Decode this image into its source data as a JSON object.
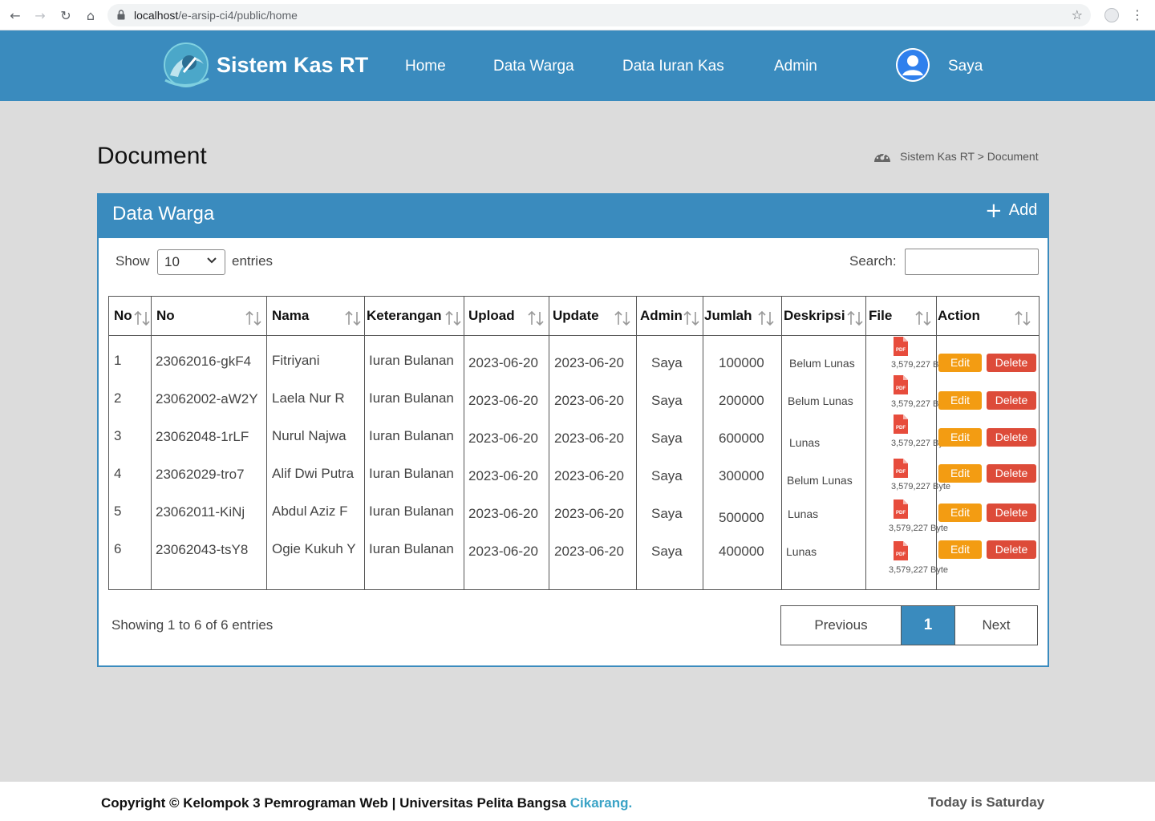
{
  "browser": {
    "url_host": "localhost",
    "url_path": "/e-arsip-ci4/public/home"
  },
  "header": {
    "brand": "Sistem Kas RT",
    "nav": [
      "Home",
      "Data Warga",
      "Data Iuran Kas",
      "Admin"
    ],
    "user": "Saya"
  },
  "page": {
    "title": "Document",
    "breadcrumb": "Sistem Kas RT > Document"
  },
  "card": {
    "title": "Data Warga",
    "add_label": "Add",
    "show_label": "Show",
    "page_length": "10",
    "entries_label": "entries",
    "search_label": "Search:",
    "search_value": ""
  },
  "table": {
    "columns": [
      "No",
      "No",
      "Nama",
      "Keterangan",
      "Upload",
      "Update",
      "Admin",
      "Jumlah",
      "Deskripsi",
      "File",
      "Action"
    ],
    "rows": [
      {
        "no": "1",
        "code": "23062016-gkF4",
        "nama": "Fitriyani",
        "ket": "Iuran Bulanan",
        "upload": "2023-06-20",
        "update": "2023-06-20",
        "admin": "Saya",
        "jumlah": "100000",
        "desc": "Belum Lunas",
        "file": "3,579,227 Byte"
      },
      {
        "no": "2",
        "code": "23062002-aW2Y",
        "nama": "Laela Nur R",
        "ket": "Iuran Bulanan",
        "upload": "2023-06-20",
        "update": "2023-06-20",
        "admin": "Saya",
        "jumlah": "200000",
        "desc": "Belum Lunas",
        "file": "3,579,227 Byte"
      },
      {
        "no": "3",
        "code": "23062048-1rLF",
        "nama": "Nurul Najwa",
        "ket": "Iuran Bulanan",
        "upload": "2023-06-20",
        "update": "2023-06-20",
        "admin": "Saya",
        "jumlah": "600000",
        "desc": "Lunas",
        "file": "3,579,227 Byte"
      },
      {
        "no": "4",
        "code": "23062029-tro7",
        "nama": "Alif Dwi Putra",
        "ket": "Iuran Bulanan",
        "upload": "2023-06-20",
        "update": "2023-06-20",
        "admin": "Saya",
        "jumlah": "300000",
        "desc": "Belum Lunas",
        "file": "3,579,227 Byte"
      },
      {
        "no": "5",
        "code": "23062011-KiNj",
        "nama": "Abdul Aziz F",
        "ket": "Iuran Bulanan",
        "upload": "2023-06-20",
        "update": "2023-06-20",
        "admin": "Saya",
        "jumlah": "500000",
        "desc": "Lunas",
        "file": "3,579,227 Byte"
      },
      {
        "no": "6",
        "code": "23062043-tsY8",
        "nama": "Ogie Kukuh Y",
        "ket": "Iuran Bulanan",
        "upload": "2023-06-20",
        "update": "2023-06-20",
        "admin": "Saya",
        "jumlah": "400000",
        "desc": "Lunas",
        "file": "3,579,227 Byte"
      }
    ],
    "edit_label": "Edit",
    "delete_label": "Delete",
    "file_icon": "pdf-file-icon"
  },
  "footer_info": {
    "showing": "Showing 1 to 6 of 6 entries",
    "prev": "Previous",
    "page": "1",
    "next": "Next"
  },
  "footer": {
    "copyright": "Copyright © Kelompok 3 Pemrograman Web | Universitas Pelita Bangsa",
    "city": "Cikarang.",
    "today": "Today is Saturday"
  },
  "colors": {
    "primary": "#3a8bbe",
    "edit": "#f39c12",
    "delete": "#dd4b39",
    "background": "#dcdcdc"
  }
}
